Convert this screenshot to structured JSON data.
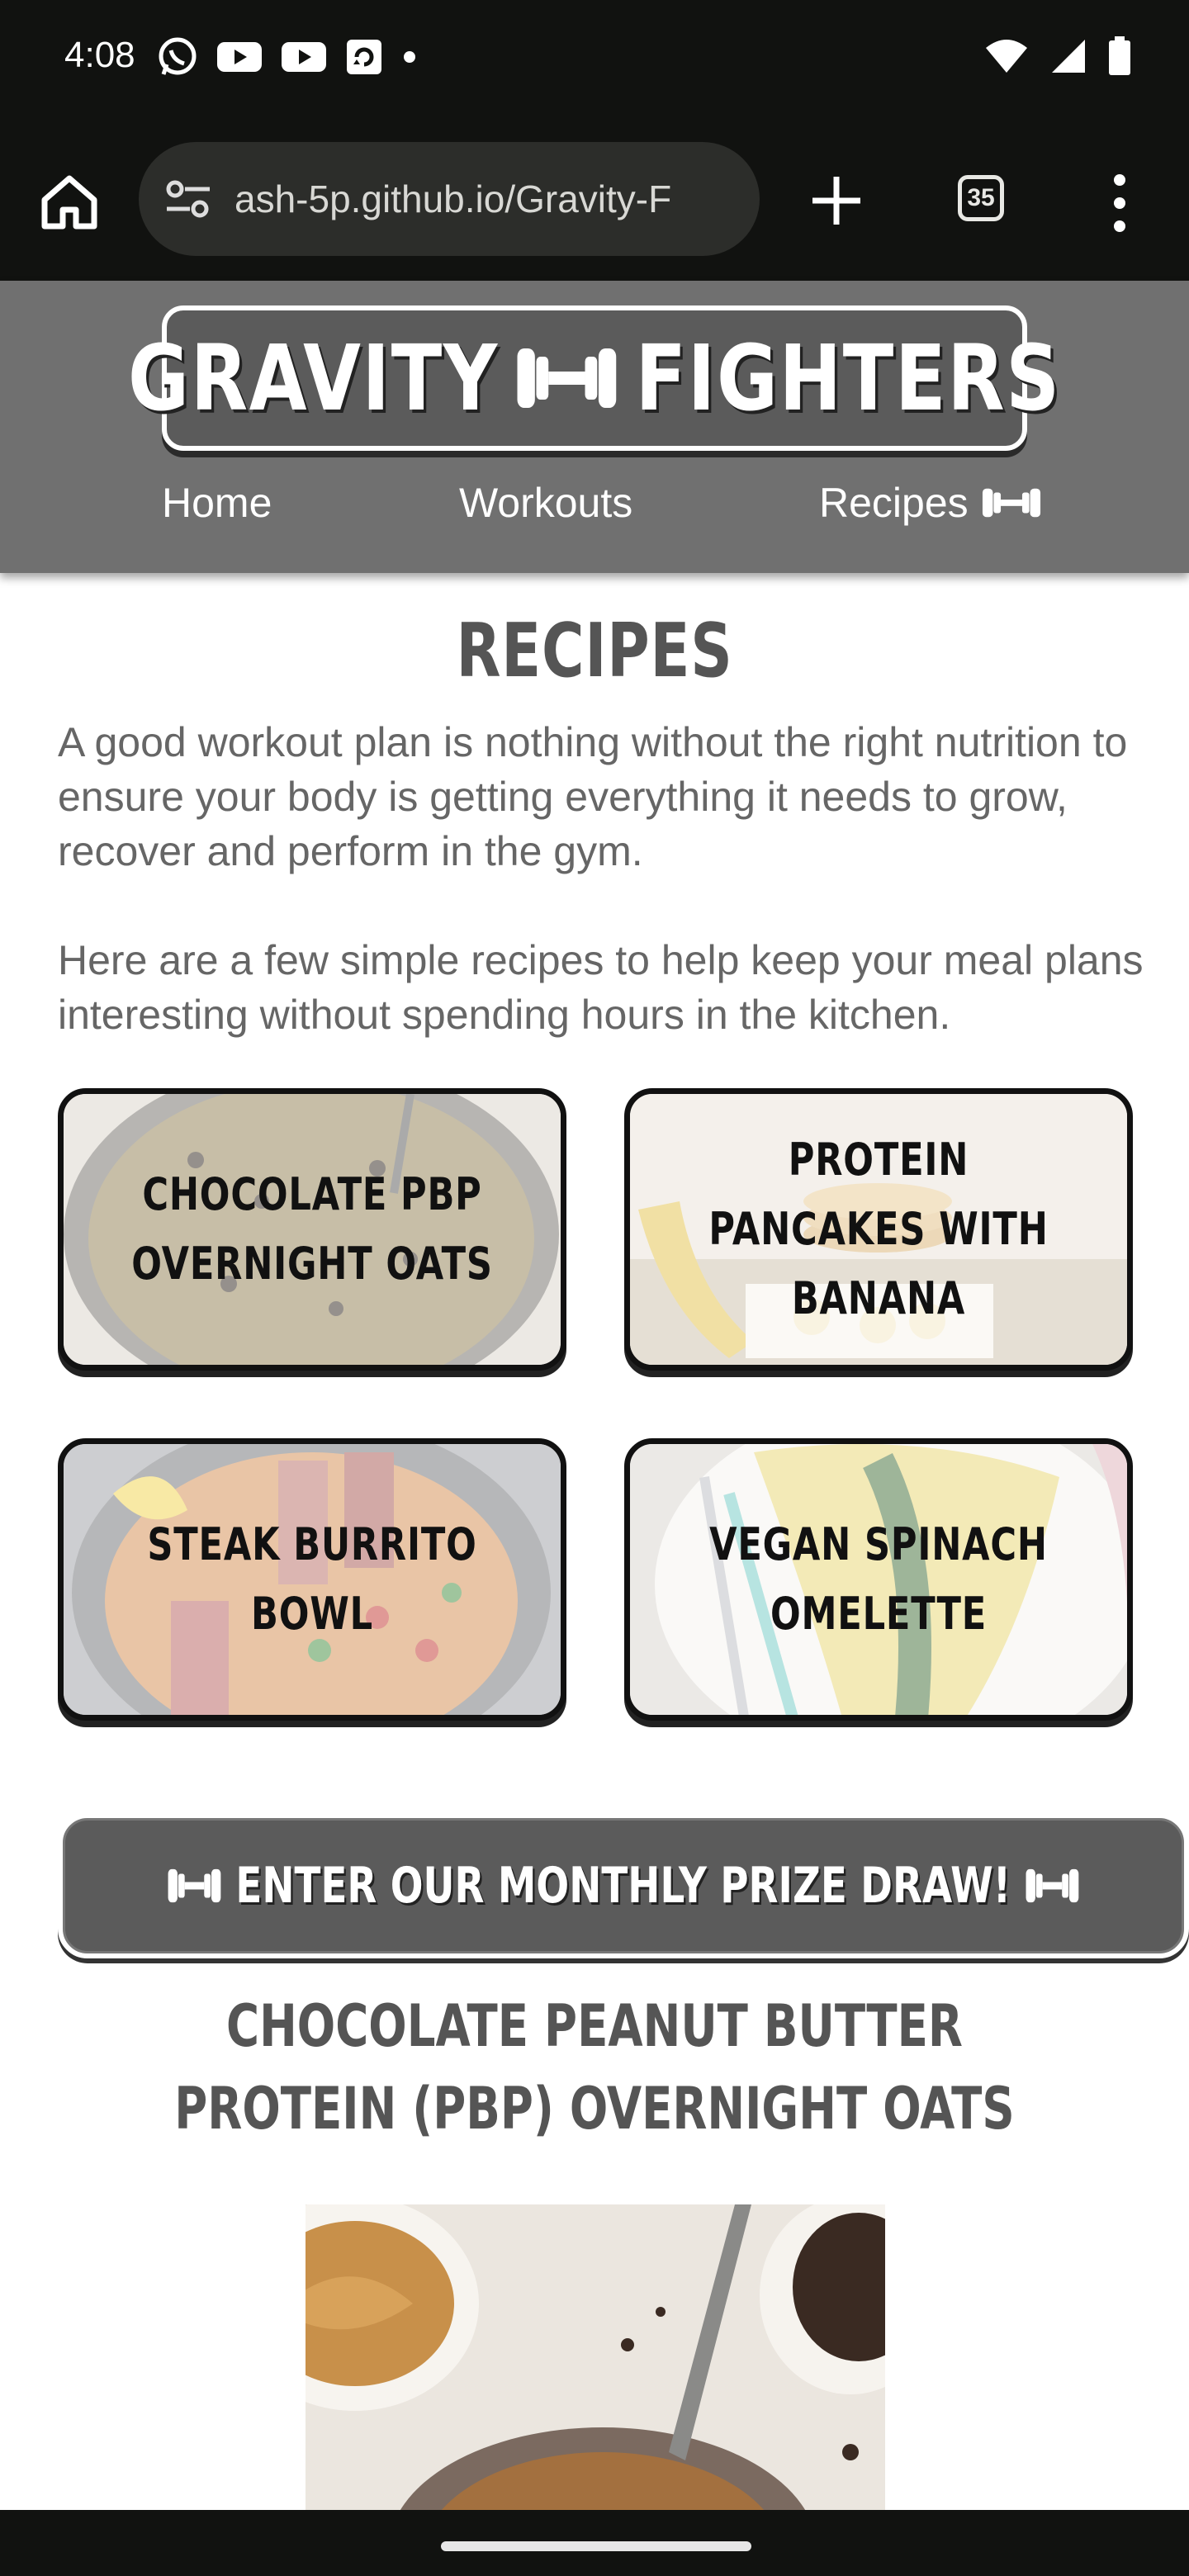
{
  "status_bar": {
    "time": "4:08",
    "icons_left": [
      "whatsapp-icon",
      "youtube-icon",
      "youtube-icon",
      "cast-icon",
      "dot-icon"
    ],
    "icons_right": [
      "wifi-icon",
      "signal-icon",
      "battery-icon"
    ]
  },
  "browser": {
    "url": "ash-5p.github.io/Gravity-F",
    "tab_count": "35"
  },
  "site": {
    "logo_left": "GRAVITY",
    "logo_right": "FIGHTERS",
    "nav": [
      {
        "label": "Home"
      },
      {
        "label": "Workouts"
      },
      {
        "label": "Recipes",
        "active": true
      }
    ]
  },
  "page": {
    "title": "RECIPES",
    "intro_1": "A good workout plan is nothing without the right nutrition to ensure your body is getting everything it needs to grow, recover and perform in the gym.",
    "intro_2": "Here are a few simple recipes to help keep your meal plans interesting without spending hours in the kitchen.",
    "cards": [
      {
        "label": "CHOCOLATE PBP OVERNIGHT OATS"
      },
      {
        "label": "PROTEIN PANCAKES WITH BANANA"
      },
      {
        "label": "STEAK BURRITO BOWL"
      },
      {
        "label": "VEGAN SPINACH OMELETTE"
      }
    ],
    "prize_button": "ENTER OUR MONTHLY PRIZE DRAW!",
    "recipe_heading": "CHOCOLATE PEANUT BUTTER PROTEIN (PBP) OVERNIGHT OATS"
  },
  "colors": {
    "header_bg": "#707070",
    "button_bg": "#5b5b5b",
    "heading_text": "#555555",
    "body_text": "#666666"
  }
}
